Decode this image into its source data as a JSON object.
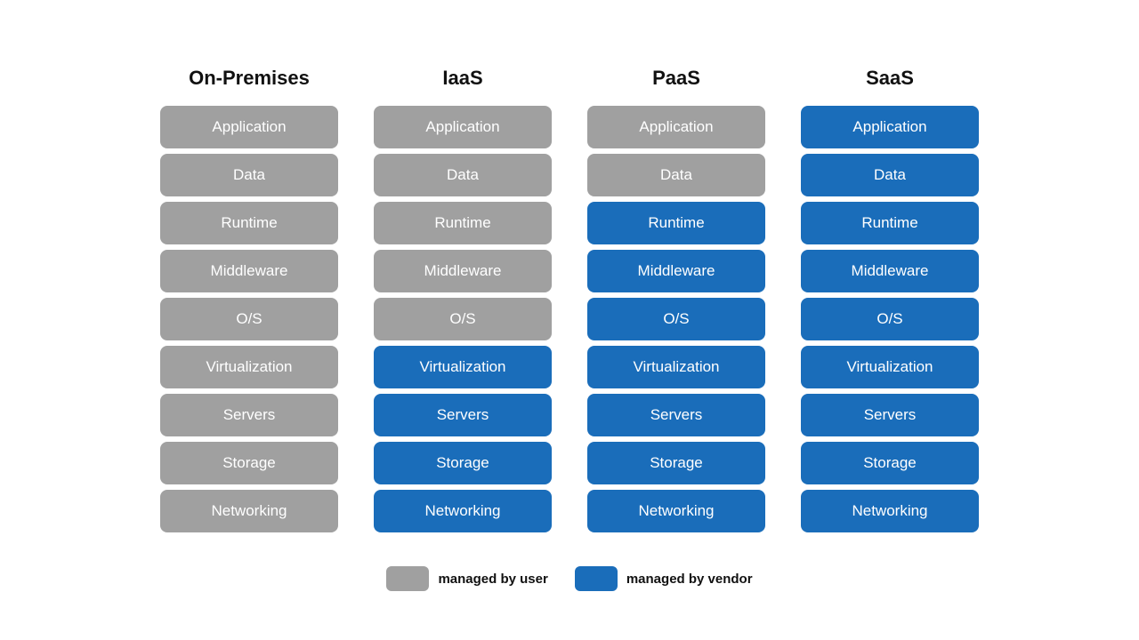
{
  "columns": [
    {
      "id": "on-premises",
      "header": "On-Premises",
      "tiles": [
        {
          "label": "Application",
          "managed": "user"
        },
        {
          "label": "Data",
          "managed": "user"
        },
        {
          "label": "Runtime",
          "managed": "user"
        },
        {
          "label": "Middleware",
          "managed": "user"
        },
        {
          "label": "O/S",
          "managed": "user"
        },
        {
          "label": "Virtualization",
          "managed": "user"
        },
        {
          "label": "Servers",
          "managed": "user"
        },
        {
          "label": "Storage",
          "managed": "user"
        },
        {
          "label": "Networking",
          "managed": "user"
        }
      ]
    },
    {
      "id": "iaas",
      "header": "IaaS",
      "tiles": [
        {
          "label": "Application",
          "managed": "user"
        },
        {
          "label": "Data",
          "managed": "user"
        },
        {
          "label": "Runtime",
          "managed": "user"
        },
        {
          "label": "Middleware",
          "managed": "user"
        },
        {
          "label": "O/S",
          "managed": "user"
        },
        {
          "label": "Virtualization",
          "managed": "vendor"
        },
        {
          "label": "Servers",
          "managed": "vendor"
        },
        {
          "label": "Storage",
          "managed": "vendor"
        },
        {
          "label": "Networking",
          "managed": "vendor"
        }
      ]
    },
    {
      "id": "paas",
      "header": "PaaS",
      "tiles": [
        {
          "label": "Application",
          "managed": "user"
        },
        {
          "label": "Data",
          "managed": "user"
        },
        {
          "label": "Runtime",
          "managed": "vendor"
        },
        {
          "label": "Middleware",
          "managed": "vendor"
        },
        {
          "label": "O/S",
          "managed": "vendor"
        },
        {
          "label": "Virtualization",
          "managed": "vendor"
        },
        {
          "label": "Servers",
          "managed": "vendor"
        },
        {
          "label": "Storage",
          "managed": "vendor"
        },
        {
          "label": "Networking",
          "managed": "vendor"
        }
      ]
    },
    {
      "id": "saas",
      "header": "SaaS",
      "tiles": [
        {
          "label": "Application",
          "managed": "vendor"
        },
        {
          "label": "Data",
          "managed": "vendor"
        },
        {
          "label": "Runtime",
          "managed": "vendor"
        },
        {
          "label": "Middleware",
          "managed": "vendor"
        },
        {
          "label": "O/S",
          "managed": "vendor"
        },
        {
          "label": "Virtualization",
          "managed": "vendor"
        },
        {
          "label": "Servers",
          "managed": "vendor"
        },
        {
          "label": "Storage",
          "managed": "vendor"
        },
        {
          "label": "Networking",
          "managed": "vendor"
        }
      ]
    }
  ],
  "legend": {
    "user_label": "managed by user",
    "vendor_label": "managed by vendor"
  }
}
